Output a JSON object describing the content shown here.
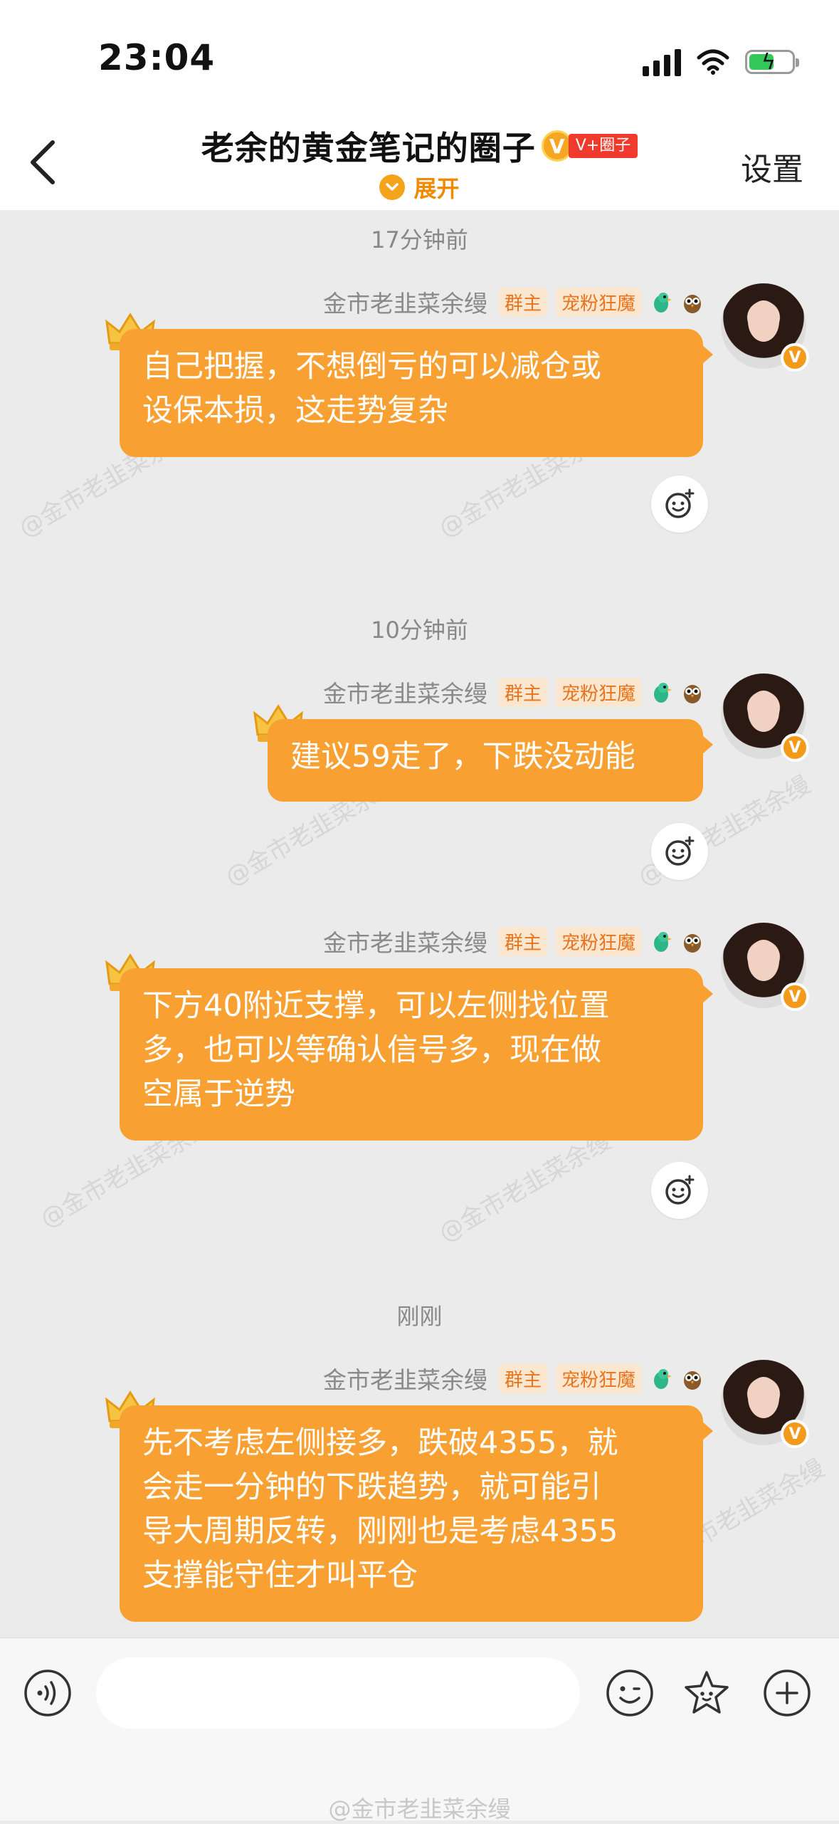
{
  "status_bar": {
    "time": "23:04"
  },
  "nav": {
    "title": "老余的黄金笔记的圈子",
    "badge_coin": "V",
    "badge_tag": "V+圈子",
    "expand_label": "展开",
    "settings_label": "设置"
  },
  "colors": {
    "bubble": "#f9a032",
    "accent": "#f08a00",
    "badge_bg": "#fbe6cf"
  },
  "messages": [
    {
      "time": "17分钟前",
      "sender": "金市老韭菜余缦",
      "role": "群主",
      "fan_badge": "宠粉狂魔",
      "text_lines": [
        "自己把握，不想倒亏的可以减仓或",
        "设保本损，这走势复杂"
      ]
    },
    {
      "time": "10分钟前",
      "sender": "金市老韭菜余缦",
      "role": "群主",
      "fan_badge": "宠粉狂魔",
      "text_lines": [
        "建议59走了，下跌没动能"
      ]
    },
    {
      "time": "",
      "sender": "金市老韭菜余缦",
      "role": "群主",
      "fan_badge": "宠粉狂魔",
      "text_lines": [
        "下方40附近支撑，可以左侧找位置",
        "多，也可以等确认信号多，现在做",
        "空属于逆势"
      ]
    },
    {
      "time": "刚刚",
      "sender": "金市老韭菜余缦",
      "role": "群主",
      "fan_badge": "宠粉狂魔",
      "text_lines": [
        "先不考虑左侧接多，跌破4355，就",
        "会走一分钟的下跌趋势，就可能引",
        "导大周期反转，刚刚也是考虑4355",
        "支撑能守住才叫平仓"
      ]
    }
  ],
  "watermark_text": "@金市老韭菜余缦",
  "input": {
    "placeholder": ""
  },
  "icons": [
    "chevron-left-icon",
    "voice-icon",
    "emoji-icon",
    "star-sticker-icon",
    "plus-icon",
    "add-reaction-icon",
    "crown-icon"
  ]
}
